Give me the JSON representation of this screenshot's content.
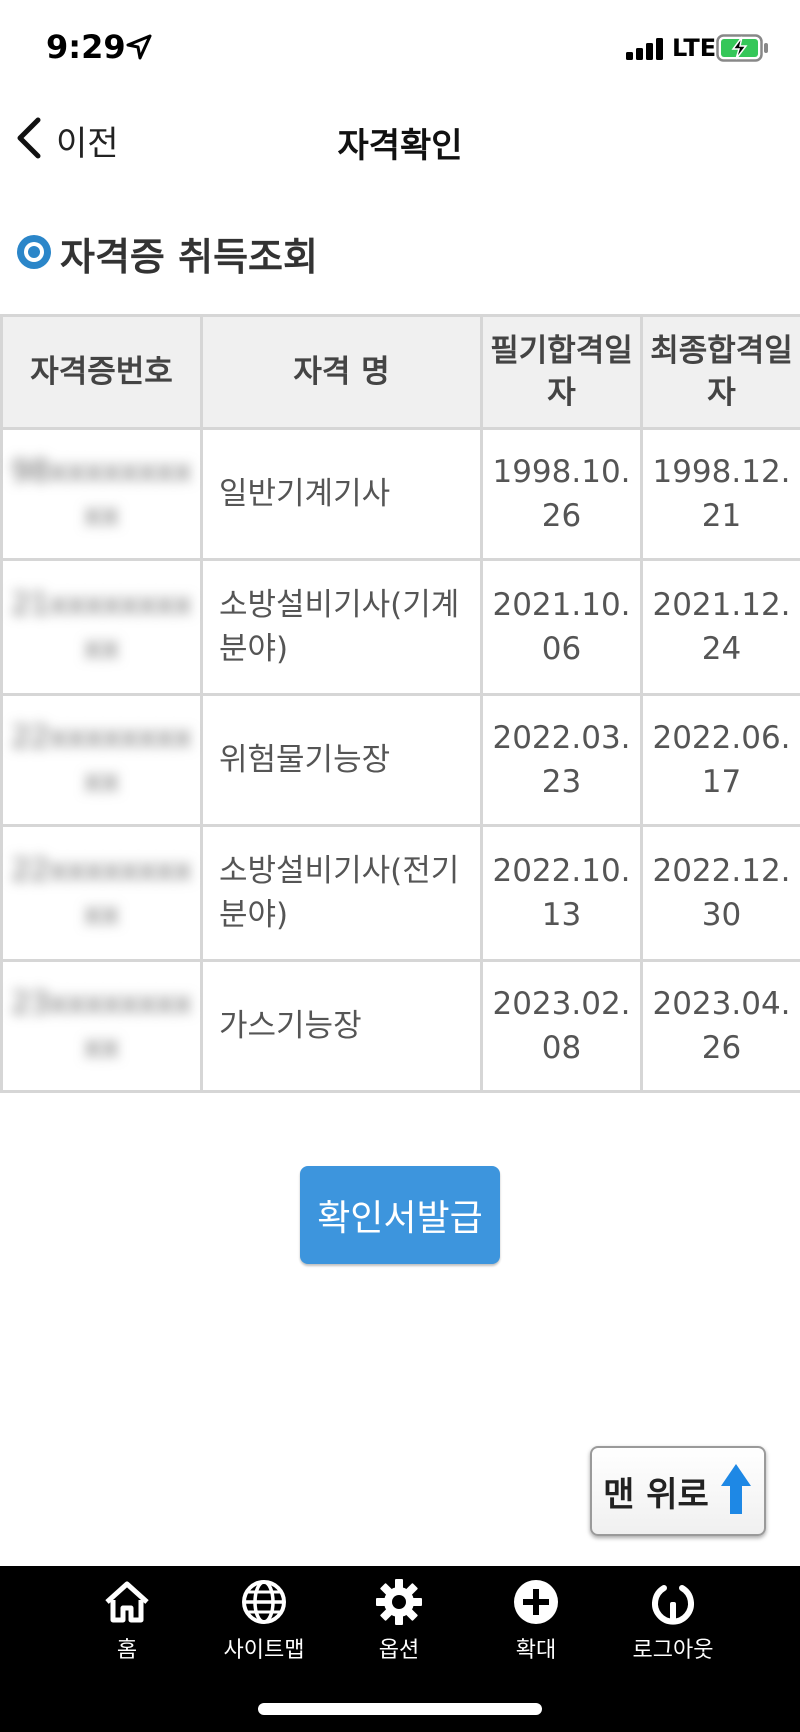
{
  "status_bar": {
    "time": "9:29",
    "network": "LTE"
  },
  "nav": {
    "back_label": "이전",
    "title": "자격확인"
  },
  "section_title": "자격증 취득조회",
  "table": {
    "headers": [
      "자격증번호",
      "자격 명",
      "필기합격일자",
      "최종합격일자"
    ],
    "rows": [
      {
        "number": "98xxxxxxxx\nxx",
        "name": "일반기계기사",
        "written": "1998.10.\n26",
        "final": "1998.12.\n21"
      },
      {
        "number": "21xxxxxxxx\nxx",
        "name": "소방설비기사(기계\n분야)",
        "written": "2021.10.\n06",
        "final": "2021.12.\n24"
      },
      {
        "number": "22xxxxxxxx\nxx",
        "name": "위험물기능장",
        "written": "2022.03.\n23",
        "final": "2022.06.\n17"
      },
      {
        "number": "22xxxxxxxx\nxx",
        "name": "소방설비기사(전기\n분야)",
        "written": "2022.10.\n13",
        "final": "2022.12.\n30"
      },
      {
        "number": "23xxxxxxxx\nxx",
        "name": "가스기능장",
        "written": "2023.02.\n08",
        "final": "2023.04.\n26"
      }
    ]
  },
  "issue_button_label": "확인서발급",
  "to_top_label": "맨 위로",
  "tabbar": {
    "items": [
      {
        "label": "홈",
        "icon": "home-icon"
      },
      {
        "label": "사이트맵",
        "icon": "globe-icon"
      },
      {
        "label": "옵션",
        "icon": "gear-icon"
      },
      {
        "label": "확대",
        "icon": "plus-circle-icon"
      },
      {
        "label": "로그아웃",
        "icon": "logout-icon"
      }
    ]
  },
  "colors": {
    "accent": "#3d95dd",
    "header_bg": "#f0f0f0",
    "border": "#d6d6d6",
    "tabbar_bg": "#000000"
  }
}
